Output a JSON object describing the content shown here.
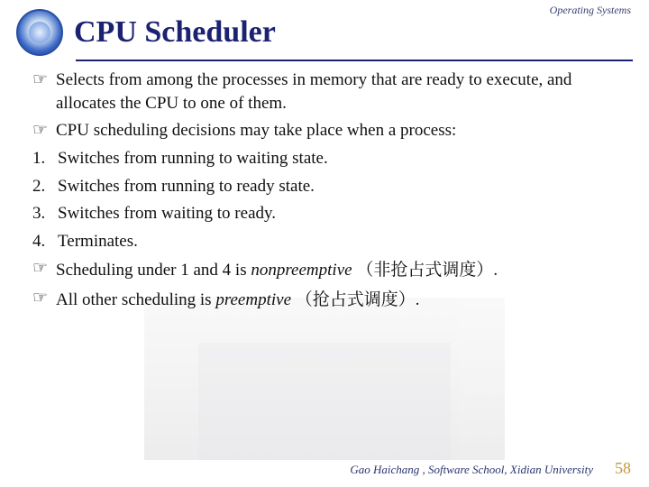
{
  "header": {
    "top_label": "Operating Systems",
    "title": "CPU Scheduler"
  },
  "bullets": {
    "b1": "Selects from among the processes in memory that are ready to execute, and allocates the CPU to one of them.",
    "b2": "CPU scheduling decisions may take place when a process:",
    "n1": "Switches from running to waiting state.",
    "n2": "Switches from running to ready state.",
    "n3": "Switches from waiting to ready.",
    "n4": "Terminates.",
    "b3_prefix": "Scheduling under 1 and 4 is ",
    "b3_em": "nonpreemptive ",
    "b3_cjk": "（非抢占式调度）",
    "b3_suffix": ".",
    "b4_prefix": "All other scheduling is ",
    "b4_em": "preemptive ",
    "b4_cjk": "（抢占式调度）",
    "b4_suffix": "."
  },
  "footer": {
    "credit": "Gao Haichang , Software School, Xidian University",
    "page": "58"
  },
  "glyphs": {
    "pointer": "☞",
    "n1": "1.",
    "n2": "2.",
    "n3": "3.",
    "n4": "4."
  }
}
